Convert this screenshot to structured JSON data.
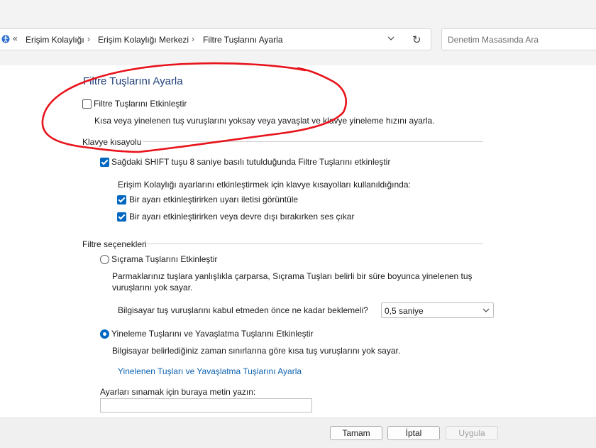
{
  "address_bar": {
    "back_symbol": "«",
    "breadcrumbs": [
      "Erişim Kolaylığı",
      "Erişim Kolaylığı Merkezi",
      "Filtre Tuşlarını Ayarla"
    ],
    "separator": "›",
    "refresh_symbol": "↻"
  },
  "search": {
    "placeholder": "Denetim Masasında Ara"
  },
  "page": {
    "title": "Filtre Tuşlarını Ayarla",
    "enable_filter_keys": {
      "label": "Filtre Tuşlarını Etkinleştir",
      "checked": false
    },
    "description": "Kısa veya yinelenen tuş vuruşlarını yoksay veya yavaşlat ve klavye yineleme hızını ayarla."
  },
  "keyboard_shortcut": {
    "heading": "Klavye kısayolu",
    "right_shift": {
      "label": "Sağdaki SHIFT tuşu 8 saniye basılı tutulduğunda Filtre Tuşlarını etkinleştir",
      "checked": true
    },
    "intro": "Erişim Kolaylığı ayarlarını etkinleştirmek için klavye kısayolları kullanıldığında:",
    "warning_message": {
      "label": "Bir ayarı etkinleştirirken uyarı iletisi görüntüle",
      "checked": true
    },
    "sound": {
      "label": "Bir ayarı etkinleştirirken veya devre dışı bırakırken ses çıkar",
      "checked": true
    }
  },
  "filter_options": {
    "heading": "Filtre seçenekleri",
    "bounce_keys": {
      "label": "Sıçrama Tuşlarını Etkinleştir",
      "selected": false,
      "description_line1": "Parmaklarınız tuşlara yanlışlıkla çarparsa, Sıçrama Tuşları belirli bir süre boyunca yinelenen tuş",
      "description_line2": "vuruşlarını yok sayar.",
      "wait_label": "Bilgisayar tuş vuruşlarını kabul etmeden önce ne kadar beklemeli?",
      "wait_value": "0,5 saniye"
    },
    "repeat_keys": {
      "label": "Yineleme Tuşlarını ve Yavaşlatma Tuşlarını Etkinleştir",
      "selected": true,
      "description": "Bilgisayar belirlediğiniz zaman sınırlarına göre kısa tuş vuruşlarını yok sayar.",
      "settings_link": "Yinelenen Tuşları ve Yavaşlatma Tuşlarını Ayarla"
    },
    "test_label": "Ayarları sınamak için buraya metin yazın:",
    "test_value": ""
  },
  "buttons": {
    "ok": "Tamam",
    "cancel": "İptal",
    "apply": "Uygula"
  },
  "colors": {
    "title": "#1e3f7a",
    "link": "#0b62b0",
    "checkbox_checked": "#0067c0",
    "annotation_ink": "#e8131b"
  }
}
